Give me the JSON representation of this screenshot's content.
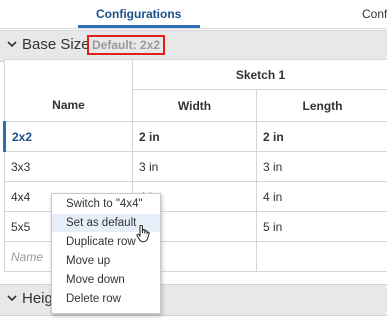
{
  "tabs": [
    {
      "label": "Configurations"
    },
    {
      "label": "Conf"
    }
  ],
  "sections": {
    "base_size": {
      "title": "Base Size",
      "default_label": "Default: 2x2"
    },
    "height": {
      "title": "Heig"
    }
  },
  "table": {
    "group_header": "Sketch 1",
    "columns": [
      "Name",
      "Width",
      "Length"
    ],
    "rows": [
      {
        "name": "2x2",
        "width": "2 in",
        "length": "2 in"
      },
      {
        "name": "3x3",
        "width": "3 in",
        "length": "3 in"
      },
      {
        "name": "4x4",
        "width": "4 in",
        "length": "4 in"
      },
      {
        "name": "5x5",
        "width": "5 in",
        "length": "5 in"
      }
    ],
    "new_row_placeholder": "Name"
  },
  "context_menu": {
    "items": [
      "Switch to \"4x4\"",
      "Set as default",
      "Duplicate row",
      "Move up",
      "Move down",
      "Delete row"
    ]
  },
  "colors": {
    "accent": "#2f6db5",
    "highlight_box": "#e0211a"
  }
}
